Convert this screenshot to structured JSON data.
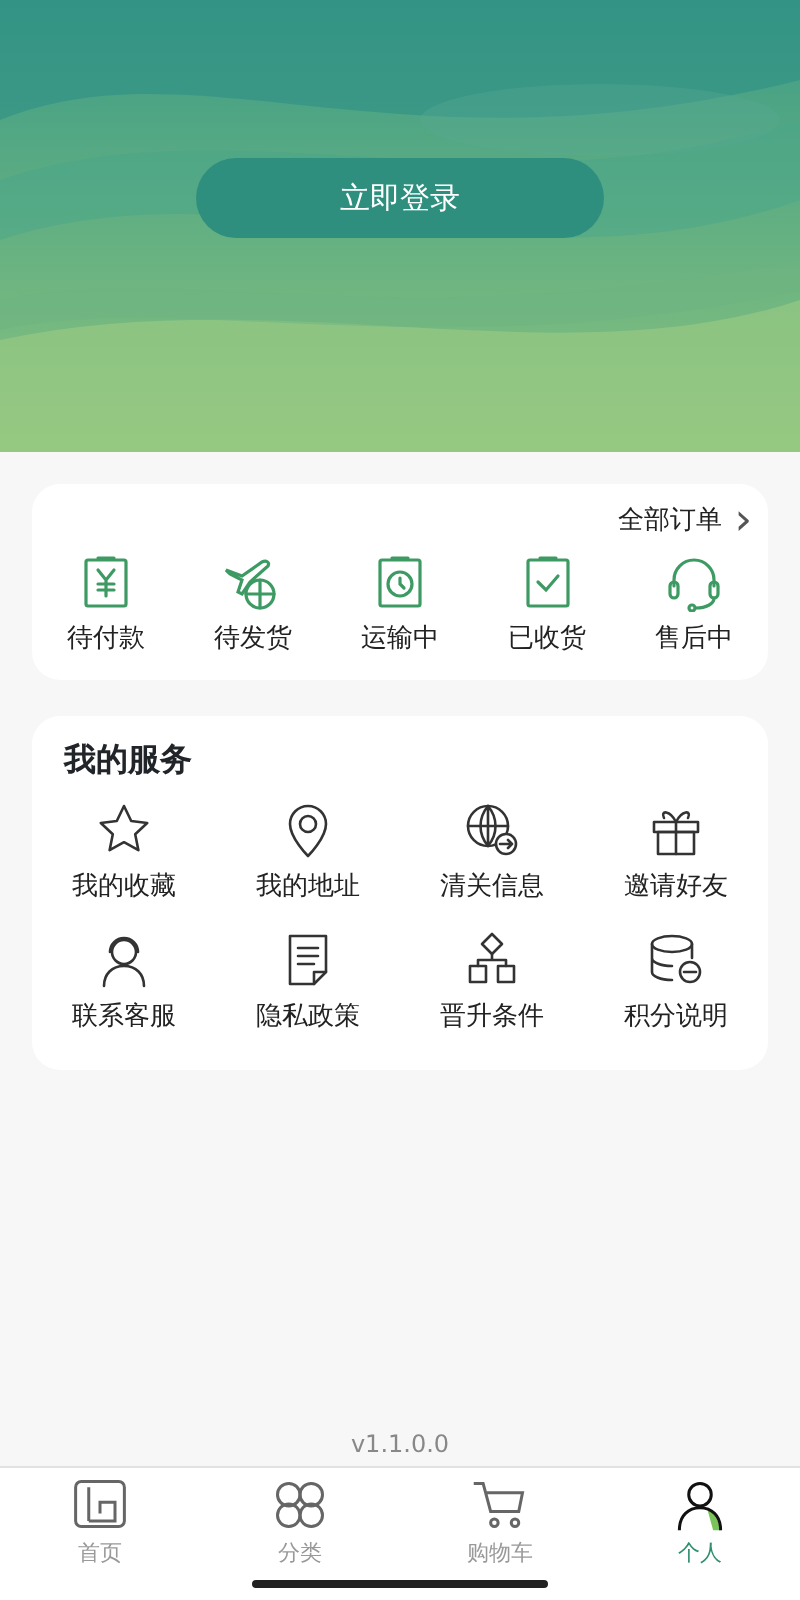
{
  "header": {
    "login_button": "立即登录"
  },
  "orders": {
    "all_link": "全部订单",
    "chevron": "›",
    "items": [
      {
        "label": "待付款"
      },
      {
        "label": "待发货"
      },
      {
        "label": "运输中"
      },
      {
        "label": "已收货"
      },
      {
        "label": "售后中"
      }
    ]
  },
  "services": {
    "title": "我的服务",
    "items": [
      {
        "label": "我的收藏"
      },
      {
        "label": "我的地址"
      },
      {
        "label": "清关信息"
      },
      {
        "label": "邀请好友"
      },
      {
        "label": "联系客服"
      },
      {
        "label": "隐私政策"
      },
      {
        "label": "晋升条件"
      },
      {
        "label": "积分说明"
      }
    ]
  },
  "version": "v1.1.0.0",
  "tab_bar": [
    {
      "label": "首页",
      "selected": false
    },
    {
      "label": "分类",
      "selected": false
    },
    {
      "label": "购物车",
      "selected": false
    },
    {
      "label": "个人",
      "selected": true
    }
  ]
}
